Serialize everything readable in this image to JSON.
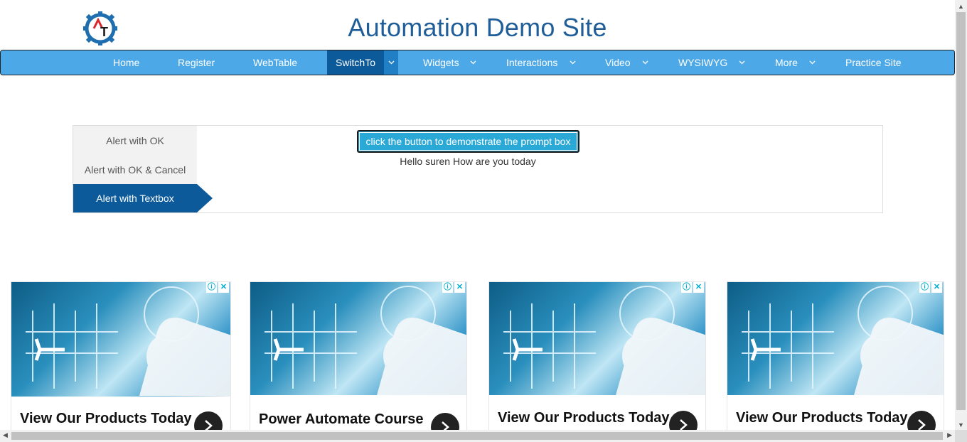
{
  "header": {
    "logo_icon": "gear-logo-icon",
    "title": "Automation Demo Site"
  },
  "nav": {
    "items": [
      {
        "label": "Home"
      },
      {
        "label": "Register"
      },
      {
        "label": "WebTable"
      },
      {
        "label": "SwitchTo"
      },
      {
        "label": "Widgets"
      },
      {
        "label": "Interactions"
      },
      {
        "label": "Video"
      },
      {
        "label": "WYSIWYG"
      },
      {
        "label": "More"
      },
      {
        "label": "Practice Site"
      }
    ],
    "active": "SwitchTo"
  },
  "tabs": {
    "items": [
      {
        "label": "Alert with OK"
      },
      {
        "label": "Alert with OK & Cancel"
      },
      {
        "label": "Alert with Textbox"
      }
    ],
    "active": "Alert with Textbox"
  },
  "content": {
    "button_label": "click the button to demonstrate the prompt box",
    "result_text": "Hello suren How are you today"
  },
  "ads": [
    {
      "title": "View Our Products Today"
    },
    {
      "title": "Power Automate Course"
    },
    {
      "title": "View Our Products Today"
    },
    {
      "title": "View Our Products Today"
    }
  ],
  "colors": {
    "nav_bg": "#4ca8e6",
    "nav_active": "#0c5a9a",
    "title_color": "#1f5e99",
    "button_bg": "#2aa8d6"
  }
}
